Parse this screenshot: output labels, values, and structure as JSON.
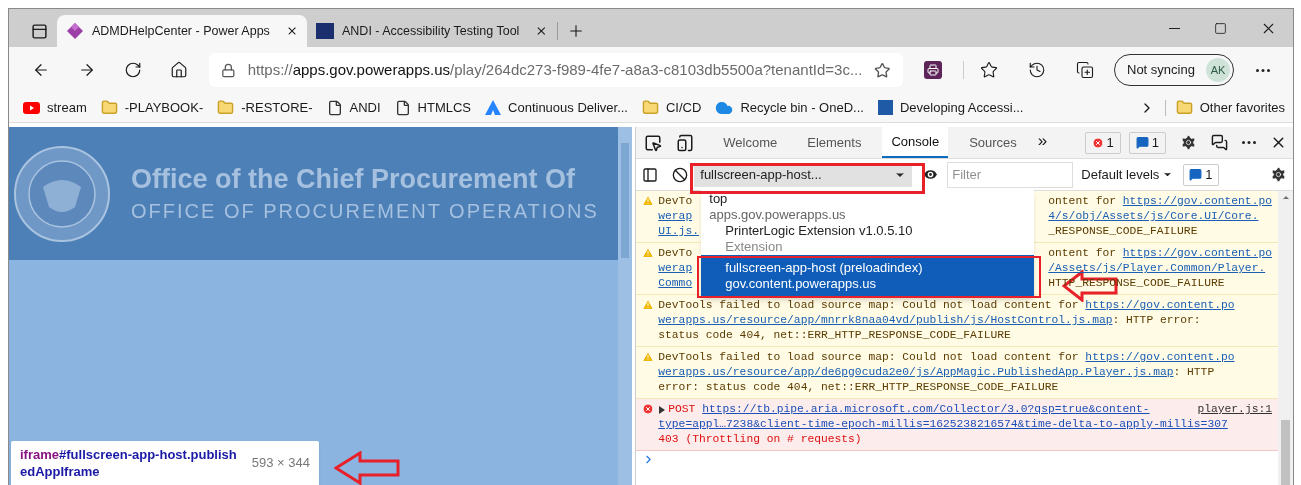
{
  "browser": {
    "tabs": [
      {
        "title": "ADMDHelpCenter - Power Apps",
        "selected": true
      },
      {
        "title": "ANDI - Accessibility Testing Tool",
        "selected": false
      }
    ],
    "address": {
      "scheme": "https://",
      "host": "apps.gov.powerapps.us",
      "path": "/play/264dc273-f989-4fe7-a8a3-c8103db5500a?tenantId=3c..."
    },
    "profile": {
      "status": "Not syncing",
      "initials": "AK"
    },
    "bookmarks": [
      {
        "label": "stream",
        "kind": "video"
      },
      {
        "label": "-PLAYBOOK-",
        "kind": "folder"
      },
      {
        "label": "-RESTORE-",
        "kind": "folder"
      },
      {
        "label": "ANDI",
        "kind": "page"
      },
      {
        "label": "HTMLCS",
        "kind": "page"
      },
      {
        "label": "Continuous Deliver...",
        "kind": "triangle"
      },
      {
        "label": "CI/CD",
        "kind": "folder"
      },
      {
        "label": "Recycle bin - OneD...",
        "kind": "cloud"
      },
      {
        "label": "Developing Accessi...",
        "kind": "badge"
      }
    ],
    "other_favorites": "Other favorites"
  },
  "page": {
    "title": "Office of the Chief Procurement Of",
    "subtitle": "OFFICE OF PROCUREMENT OPERATIONS",
    "inspect_tooltip": {
      "tag": "iframe",
      "selector": "#fullscreen-app-host.publishedAppIframe",
      "size": "593 × 344"
    }
  },
  "devtools": {
    "tabs": [
      {
        "label": "Welcome",
        "selected": false
      },
      {
        "label": "Elements",
        "selected": false
      },
      {
        "label": "Console",
        "selected": true
      },
      {
        "label": "Sources",
        "selected": false
      }
    ],
    "more_tabs": "»",
    "error_count": "1",
    "info_count": "1",
    "context": "fullscreen-app-host...",
    "filter_placeholder": "Filter",
    "levels": "Default levels",
    "issues_count": "1",
    "context_menu": [
      {
        "kind": "option",
        "label": "top",
        "selected": false
      },
      {
        "kind": "group",
        "label": "apps.gov.powerapps.us",
        "children": [
          {
            "kind": "option",
            "label": "PrinterLogic Extension v1.0.5.10",
            "detail": "Extension",
            "selected": false
          },
          {
            "kind": "option",
            "label": "fullscreen-app-host (preloadindex)",
            "detail": "gov.content.powerapps.us",
            "selected": true
          }
        ]
      }
    ],
    "messages": [
      {
        "kind": "warning",
        "lines": [
          {
            "left": [
              {
                "text": "DevTo",
                "link": false
              }
            ],
            "right": [
              {
                "text": "ontent for ",
                "link": false
              },
              {
                "text": "https://gov.content.po",
                "link": true
              }
            ]
          },
          {
            "left": [
              {
                "text": "werap",
                "link": true
              }
            ],
            "right": [
              {
                "text": "4/s/obj/Assets/js/Core.UI/Core.",
                "link": true
              }
            ]
          },
          {
            "left": [
              {
                "text": "UI.js.",
                "link": true
              }
            ],
            "right": [
              {
                "text": "_RESPONSE_CODE_FAILURE",
                "link": false
              }
            ]
          }
        ]
      },
      {
        "kind": "warning",
        "lines": [
          {
            "left": [
              {
                "text": "DevTo",
                "link": false
              }
            ],
            "right": [
              {
                "text": "ontent for ",
                "link": false
              },
              {
                "text": "https://gov.content.po",
                "link": true
              }
            ]
          },
          {
            "left": [
              {
                "text": "werap",
                "link": true
              }
            ],
            "right": [
              {
                "text": "/Assets/js/Player.Common/Player.",
                "link": true
              }
            ]
          },
          {
            "left": [
              {
                "text": "Commo",
                "link": true
              }
            ],
            "right": [
              {
                "text": "HTTP_RESPONSE_CODE_FAILURE",
                "link": false
              }
            ]
          }
        ]
      },
      {
        "kind": "warning",
        "lines": [
          {
            "left": [
              {
                "text": "DevTools failed to load source map: Could not load content for ",
                "link": false
              },
              {
                "text": "https://gov.content.po",
                "link": true
              }
            ]
          },
          {
            "left": [
              {
                "text": "werapps.us/resource/app/mnrrk8naa04vd/publish/js/HostControl.js.map",
                "link": true
              },
              {
                "text": ": HTTP error:",
                "link": false
              }
            ]
          },
          {
            "left": [
              {
                "text": "status code 404, net::ERR_HTTP_RESPONSE_CODE_FAILURE",
                "link": false
              }
            ]
          }
        ]
      },
      {
        "kind": "warning",
        "lines": [
          {
            "left": [
              {
                "text": "DevTools failed to load source map: Could not load content for ",
                "link": false
              },
              {
                "text": "https://gov.content.po",
                "link": true
              }
            ]
          },
          {
            "left": [
              {
                "text": "werapps.us/resource/app/de6pg0cuda2e0/js/AppMagic.PublishedApp.Player.js.map",
                "link": true
              },
              {
                "text": ": HTTP",
                "link": false
              }
            ]
          },
          {
            "left": [
              {
                "text": "error: status code 404, net::ERR_HTTP_RESPONSE_CODE_FAILURE",
                "link": false
              }
            ]
          }
        ]
      },
      {
        "kind": "error",
        "source": "player.js:1",
        "lines": [
          {
            "left": [
              {
                "text": "POST ",
                "link": false
              },
              {
                "text": "https://tb.pipe.aria.microsoft.com/Collector/3.0?qsp=true&content-",
                "link": true
              }
            ]
          },
          {
            "left": [
              {
                "text": "type=appl…7238&client-time-epoch-millis=1625238216574&time-delta-to-apply-millis=307",
                "link": true
              }
            ]
          },
          {
            "left": [
              {
                "text": "403 (Throttling on # requests)",
                "link": false
              }
            ]
          }
        ]
      }
    ]
  }
}
